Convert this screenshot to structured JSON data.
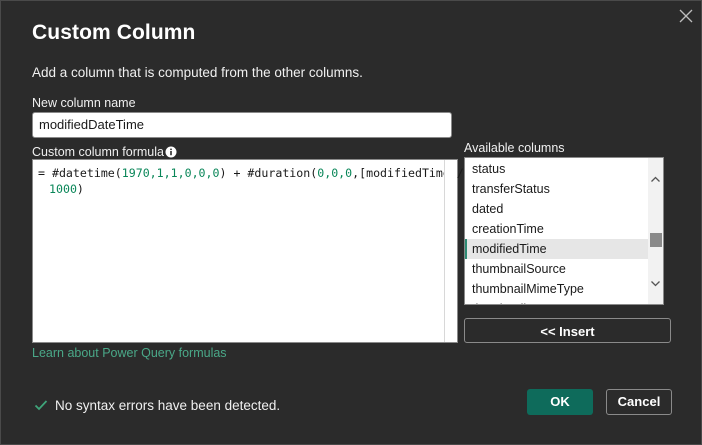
{
  "dialog": {
    "title": "Custom Column",
    "description": "Add a column that is computed from the other columns."
  },
  "name_field": {
    "label": "New column name",
    "value": "modifiedDateTime"
  },
  "formula": {
    "label": "Custom column formula",
    "line1": {
      "prefix": "= #datetime(",
      "args1": "1970,1,1,0,0,0",
      "mid": ") + #duration(",
      "args2": "0,0,0",
      "tail": ",[modifiedTime]/"
    },
    "line2": {
      "num": "1000",
      "close": ")"
    }
  },
  "learn_link": "Learn about Power Query formulas",
  "available_columns": {
    "label": "Available columns",
    "items": [
      "status",
      "transferStatus",
      "dated",
      "creationTime",
      "modifiedTime",
      "thumbnailSource",
      "thumbnailMimeType",
      "thumbnail"
    ],
    "selected": "modifiedTime"
  },
  "insert_label": "<< Insert",
  "status_text": "No syntax errors have been detected.",
  "ok_label": "OK",
  "cancel_label": "Cancel",
  "colors": {
    "accent": "#0e6b5b",
    "link": "#4aa888",
    "check": "#3fa57a",
    "background": "#2b2b2b"
  }
}
